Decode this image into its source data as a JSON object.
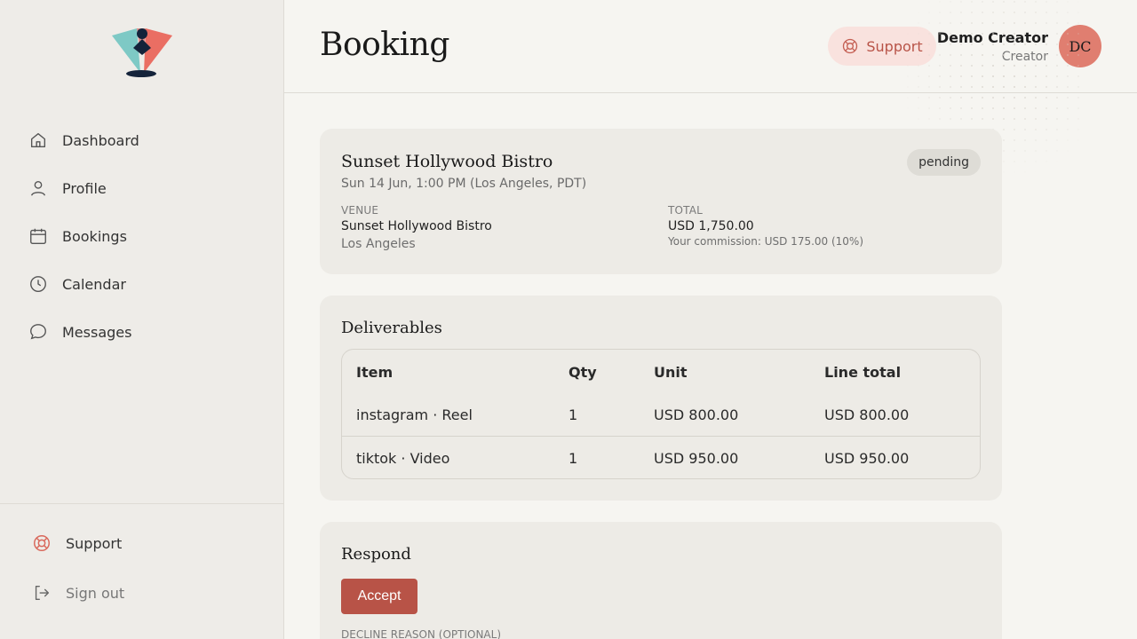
{
  "page": {
    "title": "Booking"
  },
  "sidebar": {
    "items": [
      {
        "label": "Dashboard",
        "icon": "home-icon"
      },
      {
        "label": "Profile",
        "icon": "user-icon"
      },
      {
        "label": "Bookings",
        "icon": "calendar-icon"
      },
      {
        "label": "Calendar",
        "icon": "clock-icon"
      },
      {
        "label": "Messages",
        "icon": "chat-icon"
      }
    ],
    "support_label": "Support",
    "signout_label": "Sign out"
  },
  "header": {
    "support_label": "Support",
    "user_name": "Demo Creator",
    "user_role": "Creator",
    "avatar_initials": "DC"
  },
  "booking": {
    "venue_title": "Sunset Hollywood Bistro",
    "date": "Sun 14 Jun, 1:00 PM (Los Angeles, PDT)",
    "status": "pending",
    "venue_label": "VENUE",
    "venue_name": "Sunset Hollywood Bistro",
    "venue_city": "Los Angeles",
    "total_label": "TOTAL",
    "total_value": "USD 1,750.00",
    "commission": "Your commission: USD 175.00 (10%)"
  },
  "deliverables": {
    "title": "Deliverables",
    "columns": [
      "Item",
      "Qty",
      "Unit",
      "Line total"
    ],
    "rows": [
      {
        "item": "instagram · Reel",
        "qty": "1",
        "unit": "USD 800.00",
        "line_total": "USD 800.00"
      },
      {
        "item": "tiktok · Video",
        "qty": "1",
        "unit": "USD 950.00",
        "line_total": "USD 950.00"
      }
    ]
  },
  "respond": {
    "title": "Respond",
    "accept_label": "Accept",
    "decline_reason_label": "DECLINE REASON (OPTIONAL)"
  },
  "colors": {
    "accent": "#b85347",
    "avatar": "#e07e70",
    "logo_teal": "#7ec9c5",
    "logo_coral": "#e9675c",
    "logo_navy": "#14233a"
  }
}
